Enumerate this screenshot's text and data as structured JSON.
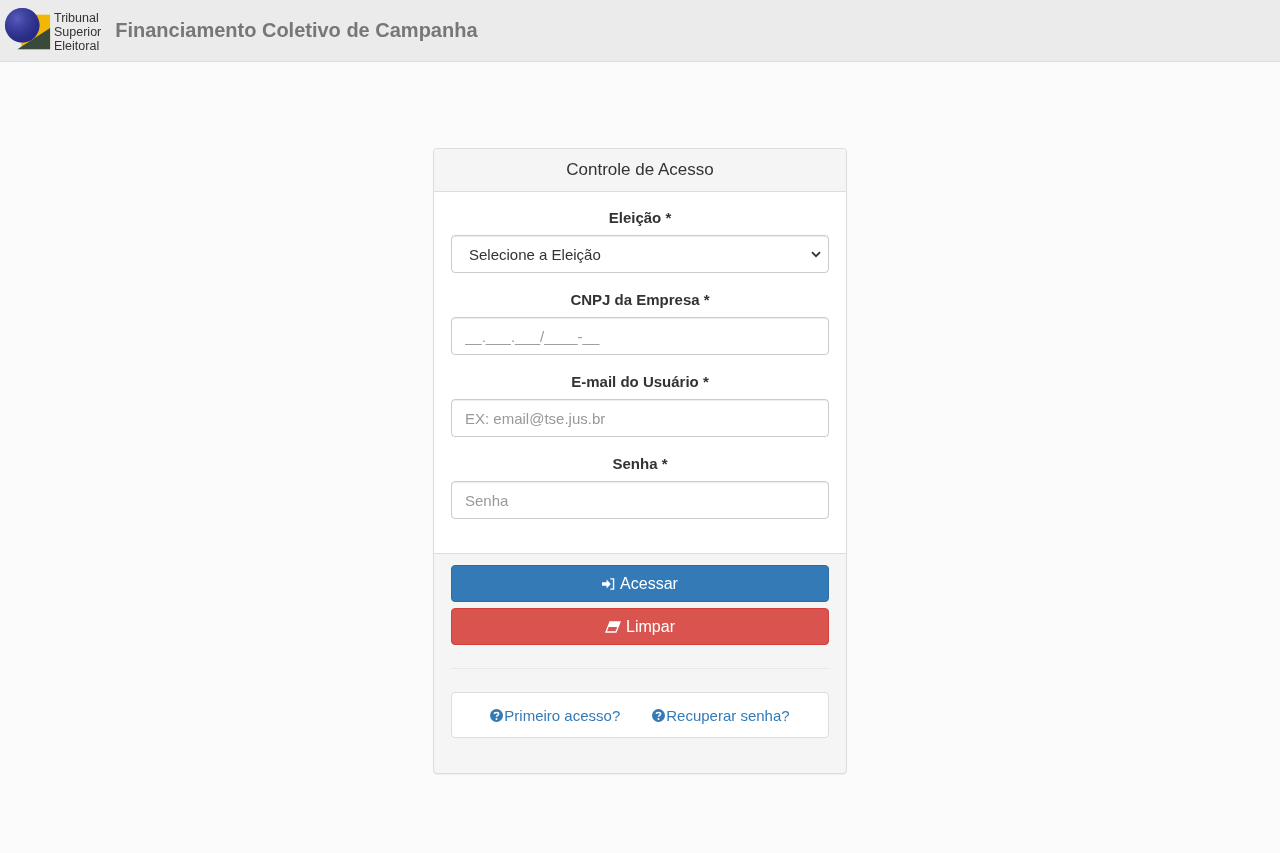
{
  "header": {
    "logo_text": [
      "Tribunal",
      "Superior",
      "Eleitoral"
    ],
    "title": "Financiamento Coletivo de Campanha"
  },
  "panel": {
    "title": "Controle de Acesso",
    "fields": [
      {
        "kind": "select",
        "label": "Eleição *",
        "value": "Selecione a Eleição"
      },
      {
        "kind": "text",
        "label": "CNPJ da Empresa *",
        "placeholder": "__.___.___/____-__"
      },
      {
        "kind": "email",
        "label": "E-mail do Usuário *",
        "placeholder": "EX: email@tse.jus.br"
      },
      {
        "kind": "password",
        "label": "Senha *",
        "placeholder": "Senha"
      }
    ],
    "buttons": [
      {
        "kind": "primary",
        "label": "Acessar"
      },
      {
        "kind": "danger",
        "label": "Limpar"
      }
    ],
    "links": [
      {
        "label": "Primeiro acesso?"
      },
      {
        "label": "Recuperar senha?"
      }
    ]
  }
}
